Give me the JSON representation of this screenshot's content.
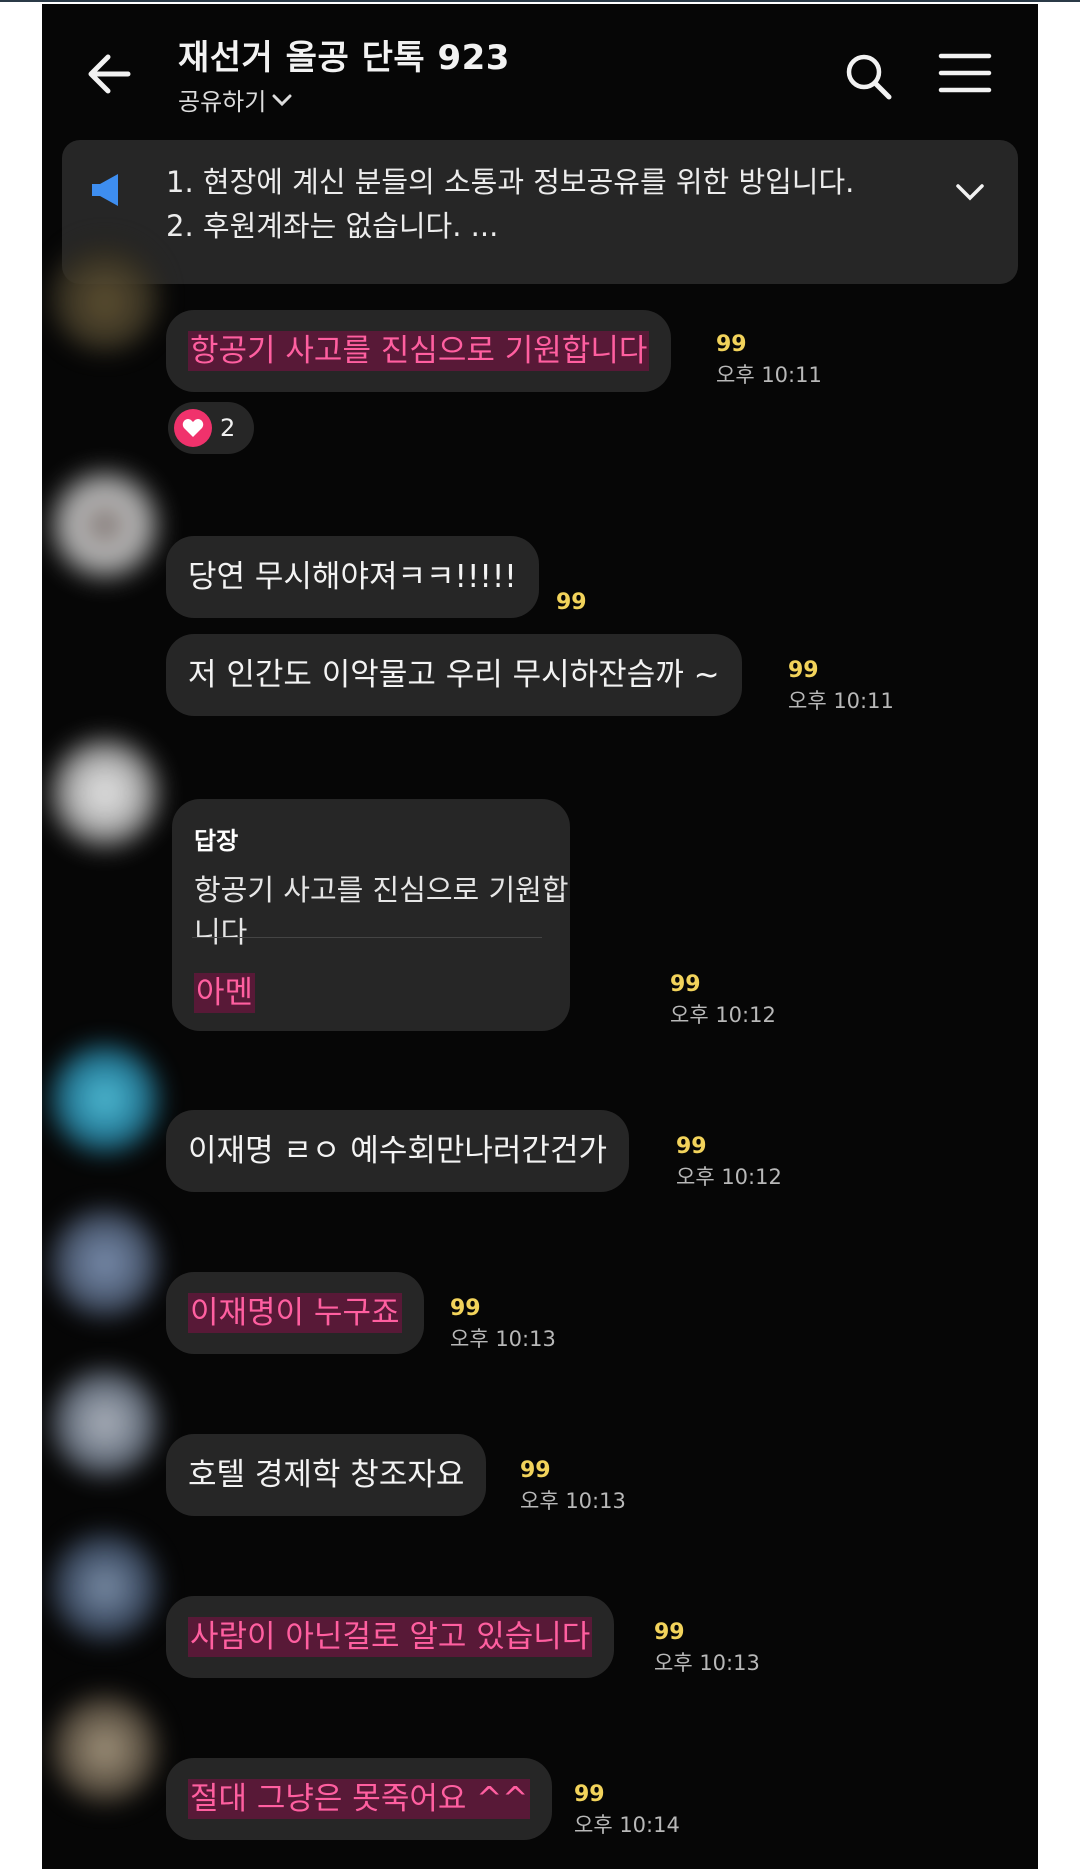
{
  "header": {
    "title": "재선거 올공 단톡 923",
    "share_label": "공유하기"
  },
  "notice": {
    "line1": "1. 현장에 계신 분들의 소통과 정보공유를 위한 방입니다.",
    "line2": "2. 후원계좌는 없습니다.  ..."
  },
  "messages": [
    {
      "text": "항공기 사고를 진심으로 기원합니다",
      "count": "99",
      "time": "오후 10:11"
    },
    {
      "text": "당연 무시해야져ㅋㅋ!!!!!",
      "count": "99"
    },
    {
      "text": "저 인간도 이악물고 우리 무시하잔슴까 ~",
      "count": "99",
      "time": "오후 10:11"
    },
    {
      "reply_header": "답장",
      "reply_quote": "항공기 사고를 진심으로 기원합니다",
      "text": "아멘",
      "count": "99",
      "time": "오후 10:12"
    },
    {
      "text": "이재명 ㄹㅇ 예수회만나러간건가",
      "count": "99",
      "time": "오후 10:12"
    },
    {
      "text": "이재명이 누구죠",
      "count": "99",
      "time": "오후 10:13"
    },
    {
      "text": "호텔 경제학 창조자요",
      "count": "99",
      "time": "오후 10:13"
    },
    {
      "text": "사람이 아닌걸로 알고 있습니다",
      "count": "99",
      "time": "오후 10:13"
    },
    {
      "text": "절대 그냥은 못죽어요 ^^",
      "count": "99",
      "time": "오후 10:14"
    }
  ],
  "reaction": {
    "count": "2"
  },
  "colors": {
    "background": "#060606",
    "bubble": "#262626",
    "pink_text": "#ff5fa0",
    "count_yellow": "#f2d35b",
    "heart": "#f0326c"
  },
  "icons": [
    "back-arrow-icon",
    "chevron-down-icon",
    "search-icon",
    "menu-icon",
    "megaphone-icon",
    "heart-icon"
  ]
}
